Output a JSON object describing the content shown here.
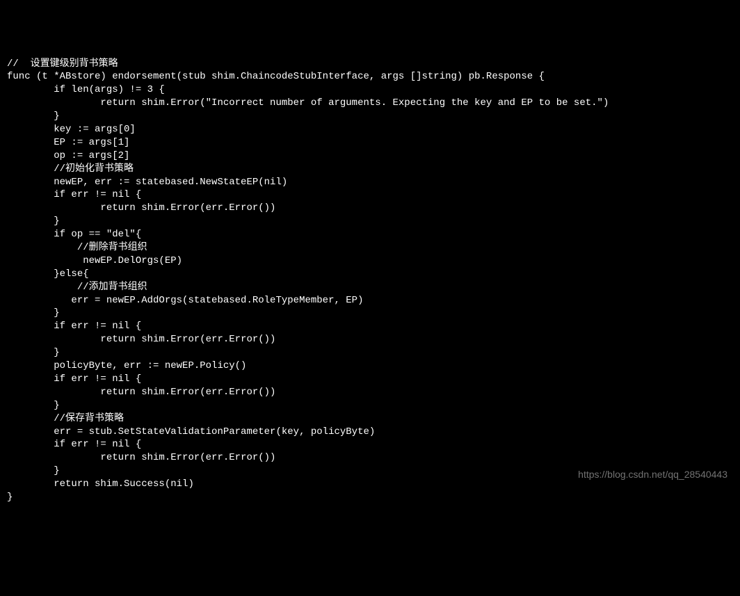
{
  "code": {
    "lines": [
      "//  设置键级别背书策略",
      "func (t *ABstore) endorsement(stub shim.ChaincodeStubInterface, args []string) pb.Response {",
      "        if len(args) != 3 {",
      "                return shim.Error(\"Incorrect number of arguments. Expecting the key and EP to be set.\")",
      "        }",
      "        key := args[0]",
      "        EP := args[1]",
      "        op := args[2]",
      "        //初始化背书策略",
      "",
      "        newEP, err := statebased.NewStateEP(nil)",
      "        if err != nil {",
      "                return shim.Error(err.Error())",
      "        }",
      "        if op == \"del\"{",
      "            //删除背书组织",
      "             newEP.DelOrgs(EP)",
      "        }else{",
      "            //添加背书组织",
      "           err = newEP.AddOrgs(statebased.RoleTypeMember, EP)",
      "        }",
      "        if err != nil {",
      "                return shim.Error(err.Error())",
      "        }",
      "",
      "",
      "        policyByte, err := newEP.Policy()",
      "        if err != nil {",
      "                return shim.Error(err.Error())",
      "        }",
      "        //保存背书策略",
      "        err = stub.SetStateValidationParameter(key, policyByte)",
      "        if err != nil {",
      "                return shim.Error(err.Error())",
      "        }",
      "        return shim.Success(nil)",
      "}"
    ]
  },
  "watermark": {
    "text": "https://blog.csdn.net/qq_28540443"
  }
}
